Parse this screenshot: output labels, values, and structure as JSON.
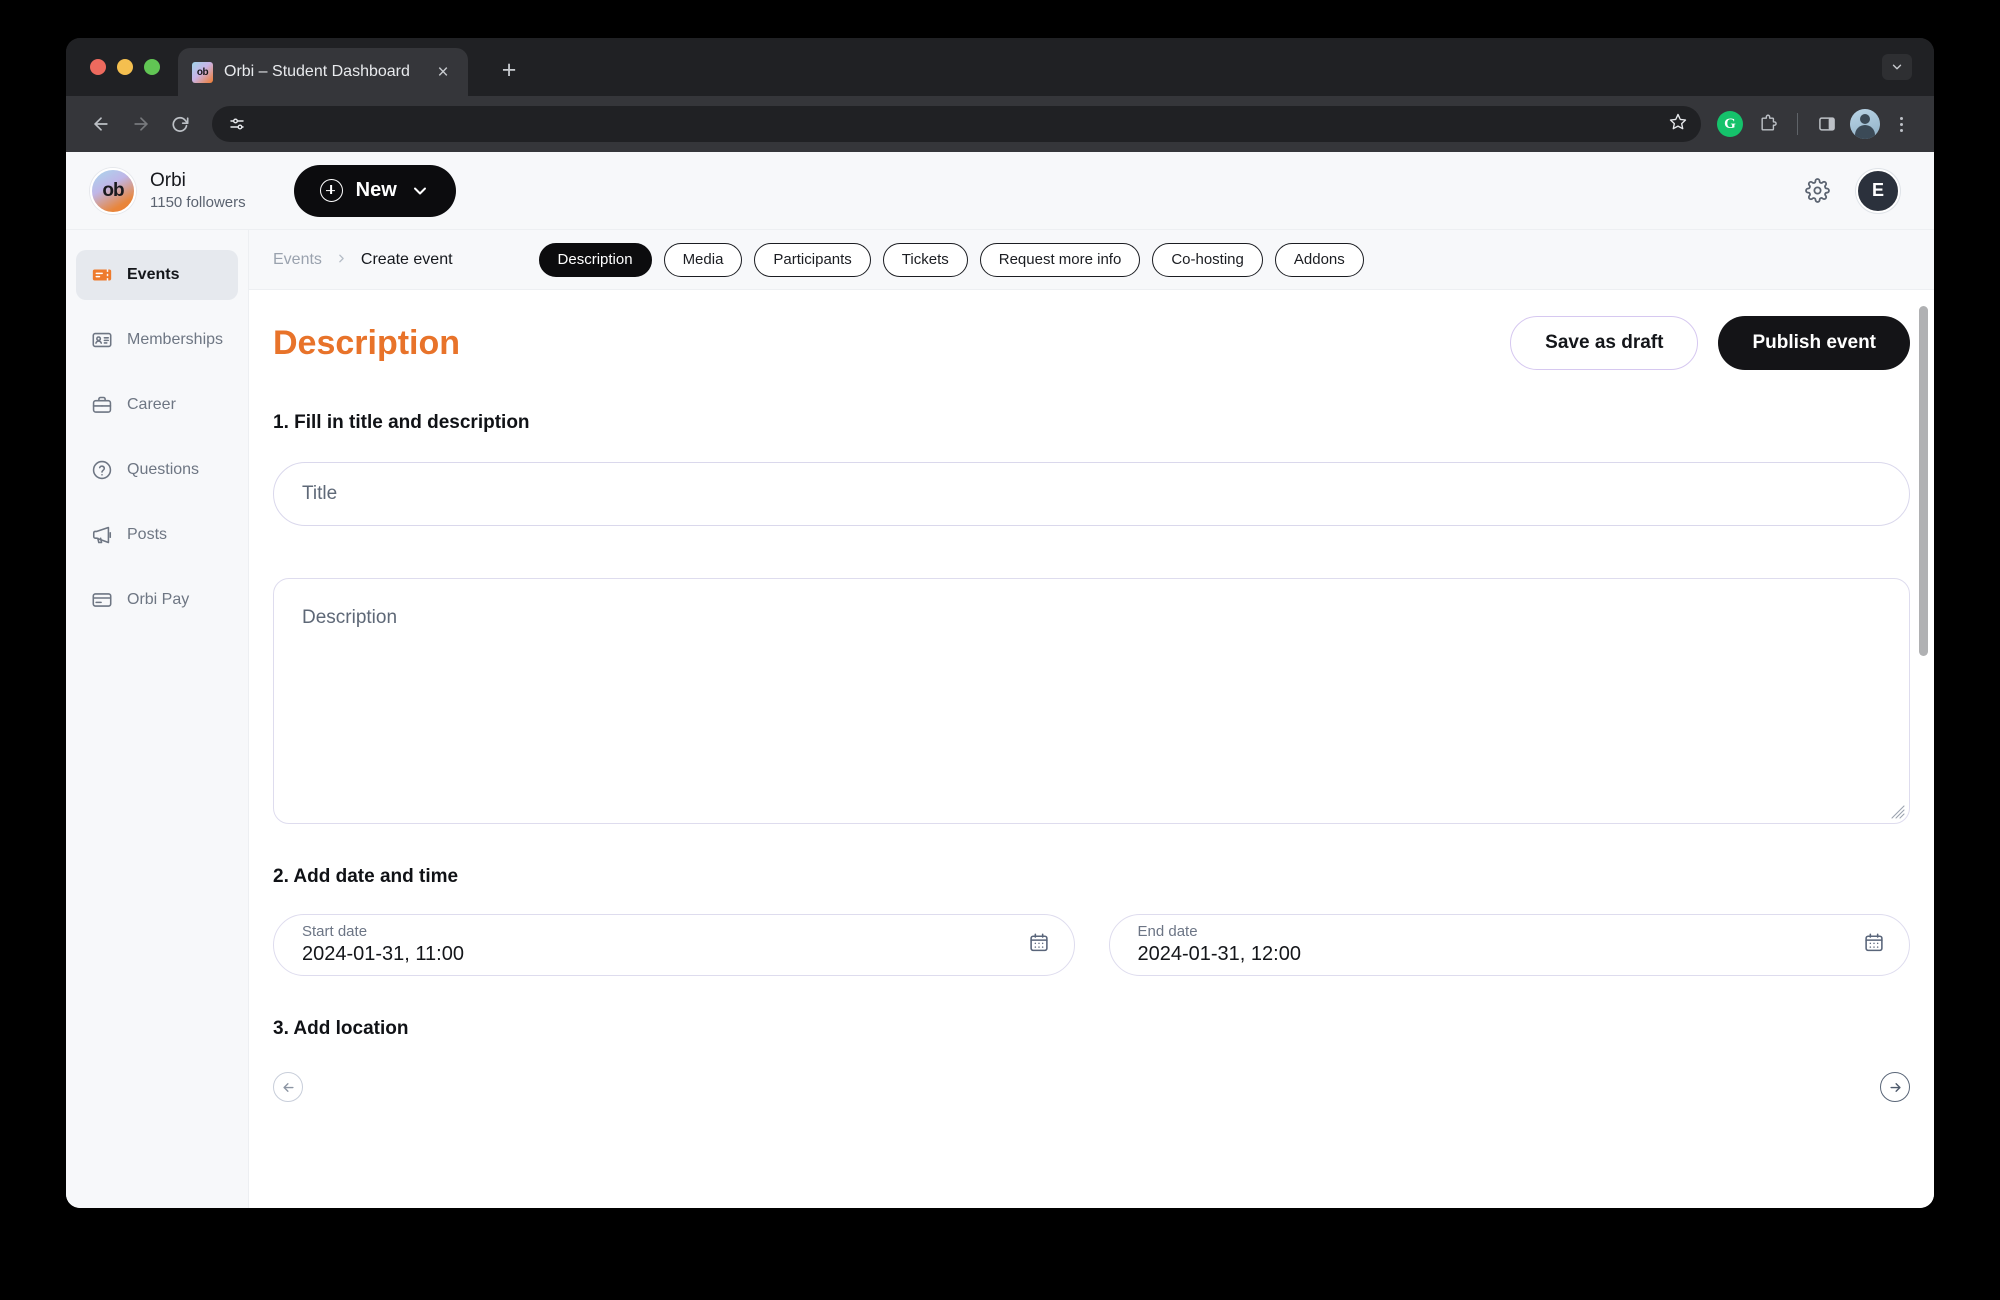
{
  "browser": {
    "tab": {
      "title": "Orbi – Student Dashboard",
      "favicon_name": "orbi-favicon",
      "close_label": "×"
    },
    "new_tab_label": "+",
    "tabstrip_chevron_name": "tab-list-chevron-icon",
    "toolbar": {
      "back_name": "back-icon",
      "forward_name": "forward-icon",
      "reload_name": "reload-icon",
      "omnibox_controls_name": "site-settings-icon",
      "bookmark_star_name": "bookmark-star-icon",
      "grammarly_label": "G",
      "extensions_name": "extensions-puzzle-icon",
      "side_panel_name": "side-panel-icon",
      "profile_name": "browser-profile-avatar",
      "menu_name": "chrome-menu-icon"
    }
  },
  "header": {
    "brand_initials": "ob",
    "brand_name": "Orbi",
    "brand_followers": "1150 followers",
    "new_button_label": "New",
    "settings_icon": "gear-icon",
    "user_initial": "E"
  },
  "sidebar": {
    "items": [
      {
        "label": "Events",
        "icon": "ticket-icon",
        "active": true
      },
      {
        "label": "Memberships",
        "icon": "id-card-icon",
        "active": false
      },
      {
        "label": "Career",
        "icon": "briefcase-icon",
        "active": false
      },
      {
        "label": "Questions",
        "icon": "question-circle-icon",
        "active": false
      },
      {
        "label": "Posts",
        "icon": "megaphone-icon",
        "active": false
      },
      {
        "label": "Orbi Pay",
        "icon": "credit-card-icon",
        "active": false
      }
    ]
  },
  "breadcrumb": {
    "parent": "Events",
    "separator": "›",
    "current": "Create event"
  },
  "tabs": [
    {
      "label": "Description",
      "active": true
    },
    {
      "label": "Media",
      "active": false
    },
    {
      "label": "Participants",
      "active": false
    },
    {
      "label": "Tickets",
      "active": false
    },
    {
      "label": "Request more info",
      "active": false
    },
    {
      "label": "Co-hosting",
      "active": false
    },
    {
      "label": "Addons",
      "active": false
    }
  ],
  "page": {
    "title": "Description",
    "title_color": "#E8732A",
    "save_draft_label": "Save as draft",
    "publish_label": "Publish event"
  },
  "form": {
    "section1_title": "1. Fill in title and description",
    "title_field": {
      "value": "",
      "placeholder": "Title"
    },
    "description_field": {
      "value": "",
      "placeholder": "Description"
    },
    "section2_title": "2. Add date and time",
    "start_date": {
      "label": "Start date",
      "value": "2024-01-31, 11:00",
      "icon": "calendar-icon"
    },
    "end_date": {
      "label": "End date",
      "value": "2024-01-31, 12:00",
      "icon": "calendar-icon"
    },
    "section3_title": "3. Add location"
  },
  "footer_nav": {
    "prev_name": "previous-step-arrow",
    "next_name": "next-step-arrow"
  }
}
